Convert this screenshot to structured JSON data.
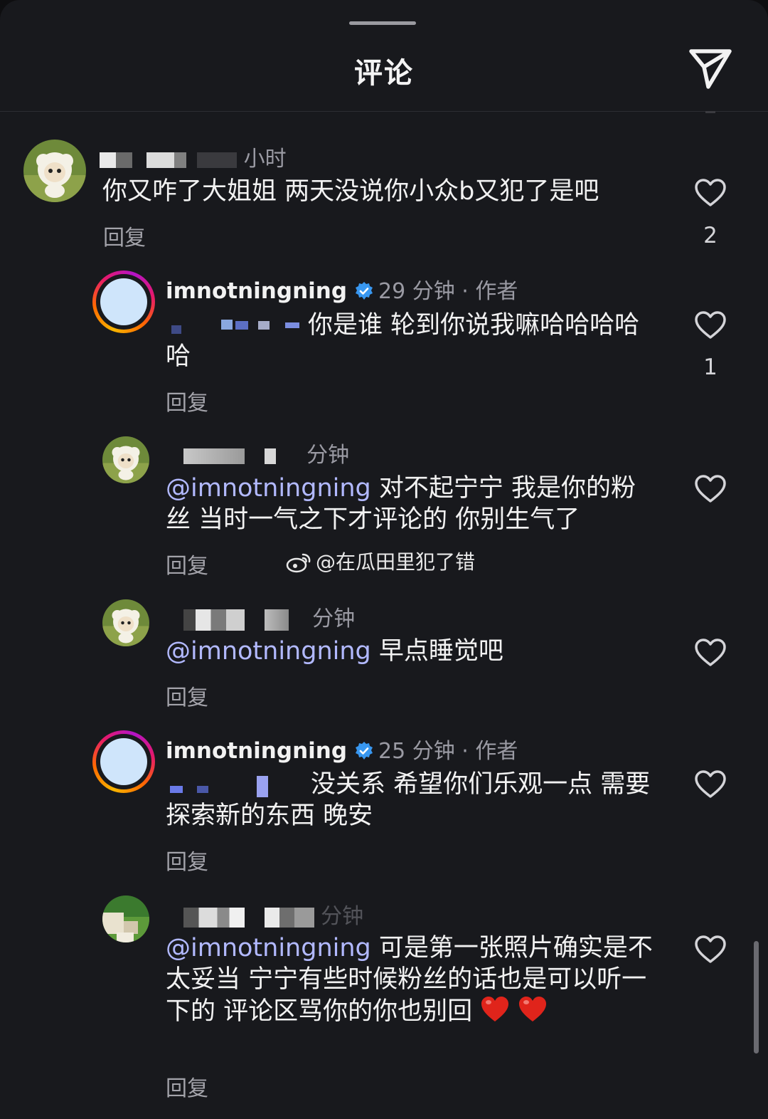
{
  "header": {
    "title": "评论",
    "send_icon": "send-icon"
  },
  "comments": [
    {
      "time": "小时",
      "text": "你又咋了大姐姐 两天没说你小众b又犯了是吧",
      "reply": "回复",
      "likes": "2"
    },
    {
      "username": "imnotningning",
      "time": "29 分钟",
      "author_tag": "· 作者",
      "text": "你是谁 轮到你说我嘛哈哈哈哈哈",
      "reply": "回复",
      "likes": "1"
    },
    {
      "time": "分钟",
      "mention": "@imnotningning",
      "text": " 对不起宁宁 我是你的粉丝 当时一气之下才评论的 你别生气了",
      "reply": "回复"
    },
    {
      "time": "分钟",
      "mention": "@imnotningning",
      "text": " 早点睡觉吧",
      "reply": "回复"
    },
    {
      "username": "imnotningning",
      "time": "25 分钟",
      "author_tag": "· 作者",
      "text": "没关系 希望你们乐观一点 需要探索新的东西 晚安",
      "reply": "回复"
    },
    {
      "time": "分钟",
      "mention": "@imnotningning",
      "text": " 可是第一张照片确实是不太妥当 宁宁有些时候粉丝的话也是可以听一下的 评论区骂你的你也别回",
      "reply": "回复"
    }
  ],
  "watermark": "@在瓜田里犯了错",
  "colors": {
    "background": "#18191d",
    "mention": "#b2b9ff",
    "verified": "#3897f0",
    "secondary_text": "#9a9aa3"
  }
}
